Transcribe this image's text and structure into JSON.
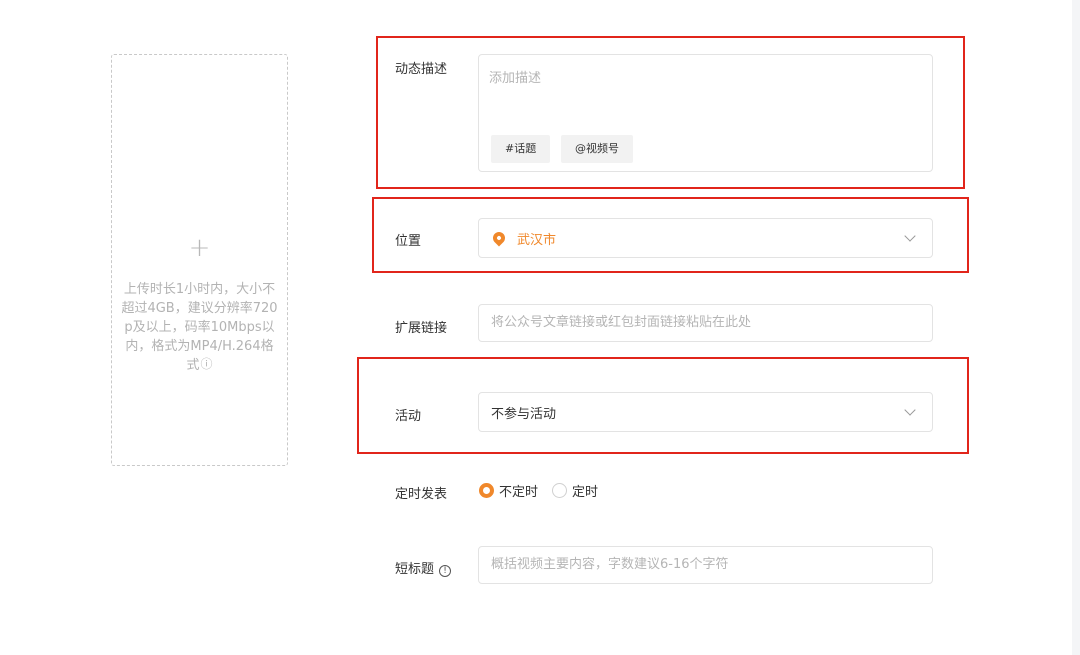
{
  "upload": {
    "plus": "+",
    "hint": "上传时长1小时内，大小不超过4GB，建议分辨率720p及以上，码率10Mbps以内，格式为MP4/H.264格式",
    "info_icon": "ⓘ"
  },
  "description": {
    "label": "动态描述",
    "placeholder": "添加描述",
    "chips": {
      "topic": "#话题",
      "mention": "@视频号"
    }
  },
  "location": {
    "label": "位置",
    "value": "武汉市",
    "icon": "location-pin-icon"
  },
  "extension_link": {
    "label": "扩展链接",
    "placeholder": "将公众号文章链接或红包封面链接粘贴在此处"
  },
  "activity": {
    "label": "活动",
    "value": "不参与活动"
  },
  "schedule": {
    "label": "定时发表",
    "options": [
      {
        "label": "不定时",
        "checked": true
      },
      {
        "label": "定时",
        "checked": false
      }
    ]
  },
  "short_title": {
    "label": "短标题",
    "help_icon": "!",
    "placeholder": "概括视频主要内容，字数建议6-16个字符"
  },
  "colors": {
    "accent": "#f0882b",
    "highlight": "#e1251b"
  }
}
